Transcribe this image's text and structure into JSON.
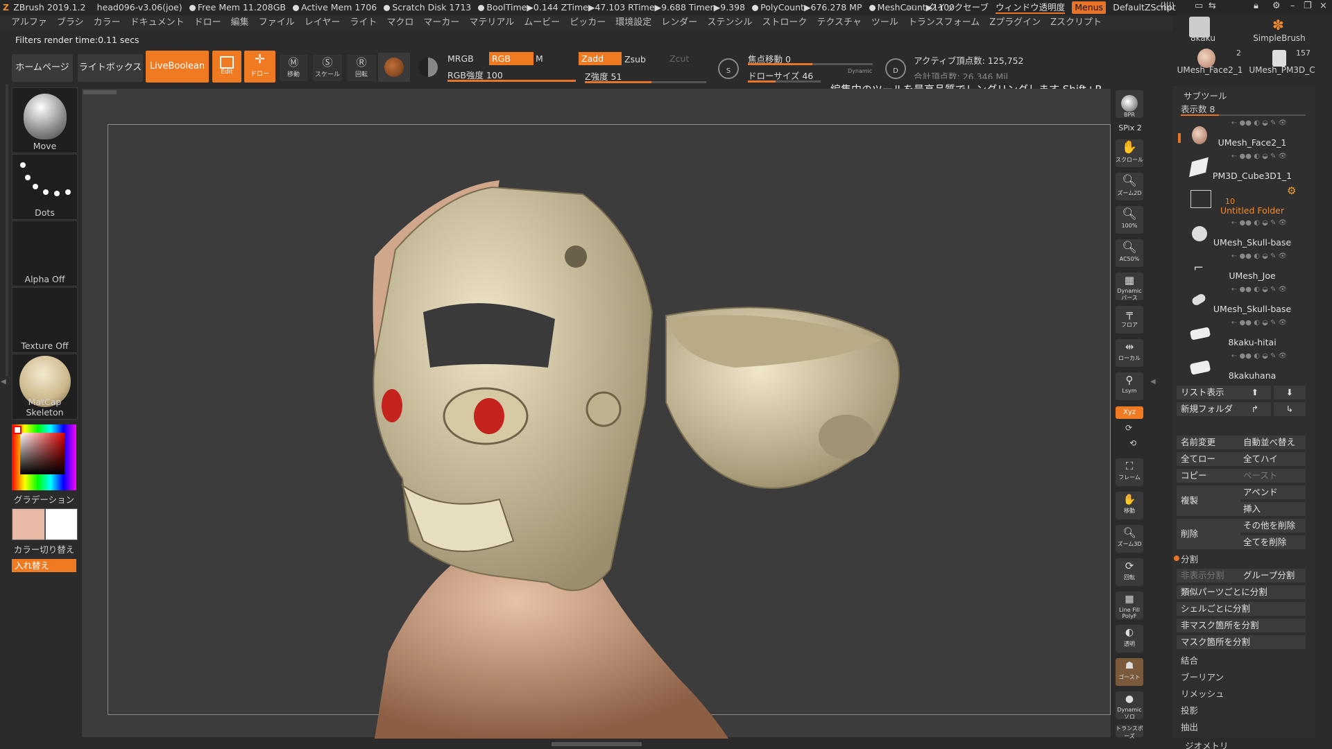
{
  "titlebar": {
    "app": "ZBrush 2019.1.2",
    "file": "head096-v3.06(joe)",
    "free_mem": "Free Mem 11.208GB",
    "active_mem": "Active Mem 1706",
    "scratch": "Scratch Disk 1713",
    "timing": "BoolTime▶0.144 ZTime▶47.103 RTime▶9.688 Timer▶9.398",
    "polycount": "PolyCount▶676.278 MP",
    "meshcount": "MeshCount▶1100",
    "ac": "AC",
    "quicksave": "クイックセーブ",
    "transparency": "ウィンドウ透明度",
    "menus": "Menus",
    "script": "DefaultZScript"
  },
  "menubar": [
    "アルファ",
    "ブラシ",
    "カラー",
    "ドキュメント",
    "ドロー",
    "編集",
    "ファイル",
    "レイヤー",
    "ライト",
    "マクロ",
    "マーカー",
    "マテリアル",
    "ムービー",
    "ピッカー",
    "環境設定",
    "レンダー",
    "ステンシル",
    "ストローク",
    "テクスチャ",
    "ツール",
    "トランスフォーム",
    "Zプラグイン",
    "Zスクリプト"
  ],
  "status": "Filters render time:0.11 secs",
  "toolbar": {
    "home": "ホームページ",
    "lightbox": "ライトボックス",
    "liveboolean": "LiveBoolean",
    "edit": "Edit",
    "draw": "ドロー",
    "move": "移動",
    "scale": "スケール",
    "rotate": "回転",
    "mrgb": "MRGB",
    "rgb": "RGB",
    "m": "M",
    "rgb_intensity": "RGB強度 100",
    "zadd": "Zadd",
    "zsub": "Zsub",
    "zcut": "Zcut",
    "z_intensity": "Z強度 51",
    "focal_shift": "焦点移動 0",
    "draw_size": "ドローサイズ 46",
    "dynamic": "Dynamic",
    "active_points": "アクティブ頂点数: 125,752",
    "total_points": "合計頂点数: 26.346 Mil",
    "tooltip": "編集中のツールを最高品質でレンダリングします  Shift+R"
  },
  "left_shelf": {
    "brush": "Move",
    "stroke": "Dots",
    "alpha": "Alpha Off",
    "texture": "Texture Off",
    "material": "MatCap Skeleton",
    "gradient": "グラデーション",
    "color_switch": "カラー切り替え",
    "swap": "入れ替え"
  },
  "right_shelf": [
    "BPR",
    "SPix 2",
    "スクロール",
    "ズーム2D",
    "100%",
    "AC50%",
    "Dynamic パース",
    "フロア",
    "ローカル",
    "Lsym",
    "Xyz",
    "フレーム",
    "移動",
    "ズーム3D",
    "回転",
    "Line Fill PolyF",
    "透明",
    "ゴースト",
    "Dynamic ソロ",
    "トランスポーズ"
  ],
  "tool_thumbs": {
    "a": "8kaku",
    "b": "SimpleBrush",
    "c": "UMesh_Face2_1",
    "d": "UMesh_PM3D_C",
    "count": "2",
    "count2": "157"
  },
  "subtool": {
    "title": "サブツール",
    "visible_count": "表示数 8",
    "items": [
      {
        "name": "UMesh_Face2_1"
      },
      {
        "name": "PM3D_Cube3D1_1"
      },
      {
        "name": "Untitled Folder",
        "count": "10"
      },
      {
        "name": "UMesh_Skull-base"
      },
      {
        "name": "UMesh_Joe"
      },
      {
        "name": "UMesh_Skull-base"
      },
      {
        "name": "8kaku-hitai"
      },
      {
        "name": "8kakuhana"
      }
    ],
    "list_view": "リスト表示",
    "new_folder": "新規フォルダ",
    "rename": "名前変更",
    "autoreorder": "自動並べ替え",
    "all_low": "全てロー",
    "all_high": "全てハイ",
    "copy": "コピー",
    "paste": "ペースト",
    "duplicate": "複製",
    "append": "アペンド",
    "insert": "挿入",
    "delete": "削除",
    "del_other": "その他を削除",
    "del_all": "全てを削除",
    "split": "分割",
    "split_hidden": "非表示分割",
    "groups_split": "グループ分割",
    "split_similar": "類似パーツごとに分割",
    "split_shells": "シェルごとに分割",
    "split_unmasked": "非マスク箇所を分割",
    "split_masked": "マスク箇所を分割",
    "merge": "結合",
    "boolean": "ブーリアン",
    "remesh": "リメッシュ",
    "project": "投影",
    "extract": "抽出",
    "geometry": "ジオメトリ"
  }
}
